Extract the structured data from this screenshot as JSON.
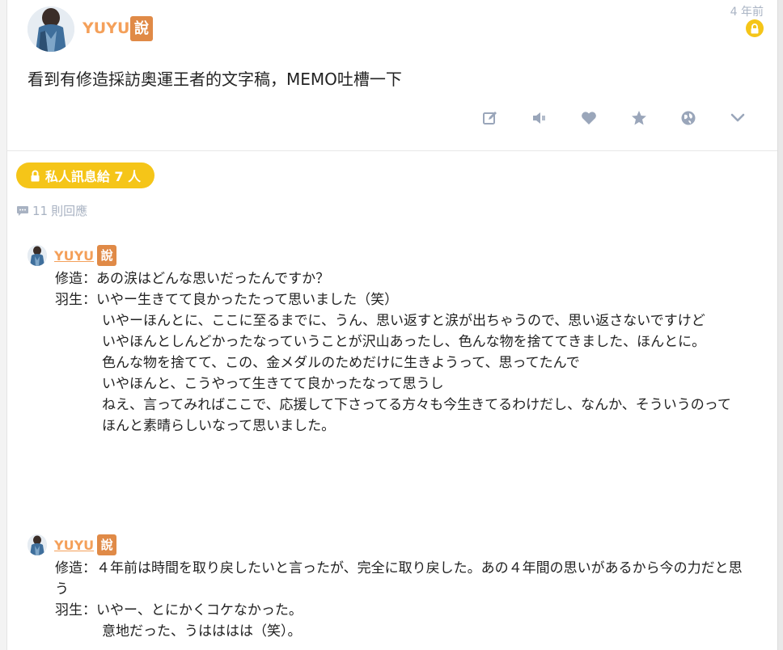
{
  "post": {
    "author": "YUYU",
    "say_badge": "說",
    "time": "4 年前",
    "text": "看到有修造採訪奧運王者的文字稿，MEMO吐槽一下",
    "icons": [
      "edit-icon",
      "speaker-icon",
      "heart-icon",
      "star-icon",
      "globe-icon",
      "chevron-down-icon"
    ],
    "accent": "#f4a05a",
    "lock_color": "#f5c518"
  },
  "private_message": {
    "label": "私人訊息給 7 人"
  },
  "replies": {
    "count": "11",
    "label": "則回應"
  },
  "comments": [
    {
      "author": "YUYU",
      "badge": "說",
      "lines": [
        "修造：あの涙はどんな思いだったんですか？",
        "羽生：いやー生きてて良かったたって思いました（笑）",
        "いやーほんとに、ここに至るまでに、うん、思い返すと涙が出ちゃうので、思い返さないですけど",
        "いやほんとしんどかったなっていうことが沢山あったし、色んな物を捨ててきました、ほんとに。",
        "色んな物を捨てて、この、金メダルのためだけに生きようって、思ってたんで",
        "いやほんと、こうやって生きてて良かったなって思うし",
        "ねえ、言ってみればここで、応援して下さってる方々も今生きてるわけだし、なんか、そういうのって",
        "ほんと素晴らしいなって思いました。"
      ]
    },
    {
      "author": "YUYU",
      "badge": "說",
      "lines": [
        "修造：４年前は時間を取り戻したいと言ったが、完全に取り戻した。あの４年間の思いがあるから今の力だと思う",
        "羽生：いやー、とにかくコケなかった。",
        "意地だった、うはははは（笑）。"
      ]
    }
  ]
}
